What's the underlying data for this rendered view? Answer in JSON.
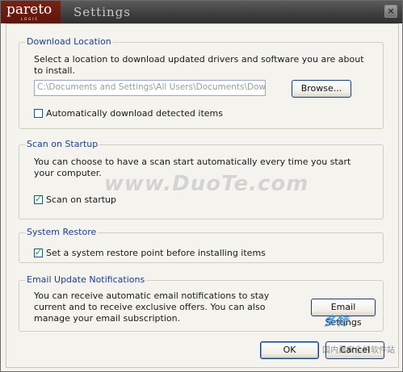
{
  "window": {
    "logo": "pareto",
    "logo_sub": "LOGIC",
    "title": "Settings",
    "close_glyph": "×"
  },
  "download": {
    "legend": "Download Location",
    "description": "Select a location to download updated drivers and software you are about to install.",
    "path_value": "C:\\Documents and Settings\\All Users\\Documents\\Download",
    "browse_label": "Browse...",
    "auto_label": "Automatically download detected items",
    "auto_checked": false
  },
  "scan": {
    "legend": "Scan on Startup",
    "description": "You can choose to have a scan start automatically every time you start your computer.",
    "checkbox_label": "Scan on startup",
    "checked": true
  },
  "restore": {
    "legend": "System Restore",
    "checkbox_label": "Set a system restore point before installing items",
    "checked": true
  },
  "email": {
    "legend": "Email Update Notifications",
    "description": "You can receive automatic email notifications to stay current and to receive exclusive offers.  You can also manage your email subscription.",
    "button_label": "Email Settings"
  },
  "footer": {
    "ok_label": "OK",
    "cancel_label": "Cancel"
  },
  "watermark": {
    "main": "www.DuoTe.com",
    "corner_main": "多特",
    "corner_sub": "国内最安全的软件站"
  },
  "colors": {
    "legend": "#1e3e8c",
    "titlebar": "#3e3e3e",
    "logo_bg": "#6a1a0e",
    "checkmark": "#21a121"
  }
}
